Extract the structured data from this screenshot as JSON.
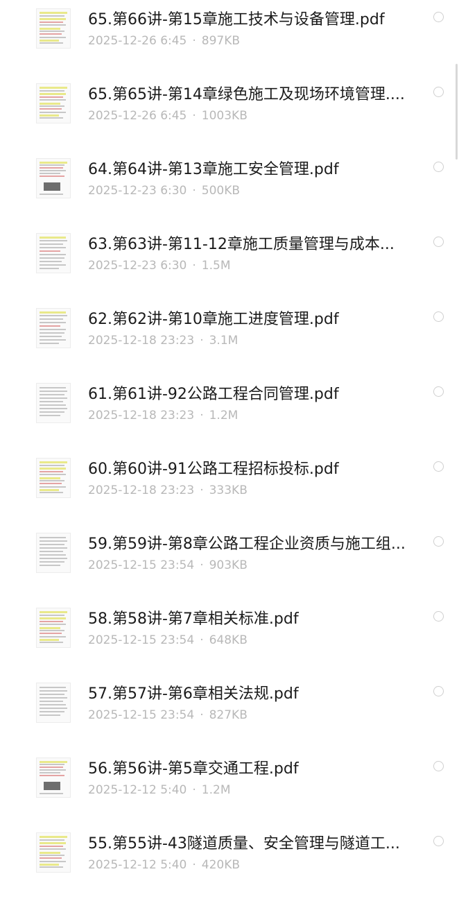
{
  "files": [
    {
      "name": "65.第66讲-第15章施工技术与设备管理.pdf",
      "date": "2025-12-26 6:45",
      "size": "897KB",
      "thumb_style": 1
    },
    {
      "name": "65.第65讲-第14章绿色施工及现场环境管理....",
      "date": "2025-12-26 6:45",
      "size": "1003KB",
      "thumb_style": 1
    },
    {
      "name": "64.第64讲-第13章施工安全管理.pdf",
      "date": "2025-12-23 6:30",
      "size": "500KB",
      "thumb_style": 2
    },
    {
      "name": "63.第63讲-第11-12章施工质量管理与成本...",
      "date": "2025-12-23 6:30",
      "size": "1.5M",
      "thumb_style": 3
    },
    {
      "name": "62.第62讲-第10章施工进度管理.pdf",
      "date": "2025-12-18 23:23",
      "size": "3.1M",
      "thumb_style": 3
    },
    {
      "name": "61.第61讲-92公路工程合同管理.pdf",
      "date": "2025-12-18 23:23",
      "size": "1.2M",
      "thumb_style": 4
    },
    {
      "name": "60.第60讲-91公路工程招标投标.pdf",
      "date": "2025-12-18 23:23",
      "size": "333KB",
      "thumb_style": 1
    },
    {
      "name": "59.第59讲-第8章公路工程企业资质与施工组...",
      "date": "2025-12-15 23:54",
      "size": "903KB",
      "thumb_style": 4
    },
    {
      "name": "58.第58讲-第7章相关标准.pdf",
      "date": "2025-12-15 23:54",
      "size": "648KB",
      "thumb_style": 1
    },
    {
      "name": "57.第57讲-第6章相关法规.pdf",
      "date": "2025-12-15 23:54",
      "size": "827KB",
      "thumb_style": 4
    },
    {
      "name": "56.第56讲-第5章交通工程.pdf",
      "date": "2025-12-12 5:40",
      "size": "1.2M",
      "thumb_style": 2
    },
    {
      "name": "55.第55讲-43隧道质量、安全管理与隧道工...",
      "date": "2025-12-12 5:40",
      "size": "420KB",
      "thumb_style": 1
    }
  ],
  "colors": {
    "title_text": "#1b1b1b",
    "meta_text": "#b8b8b8",
    "circle_border": "#cfcfcf",
    "background": "#ffffff"
  },
  "icons": {
    "thumbnail": "pdf-thumbnail-icon",
    "select": "select-circle-icon"
  }
}
